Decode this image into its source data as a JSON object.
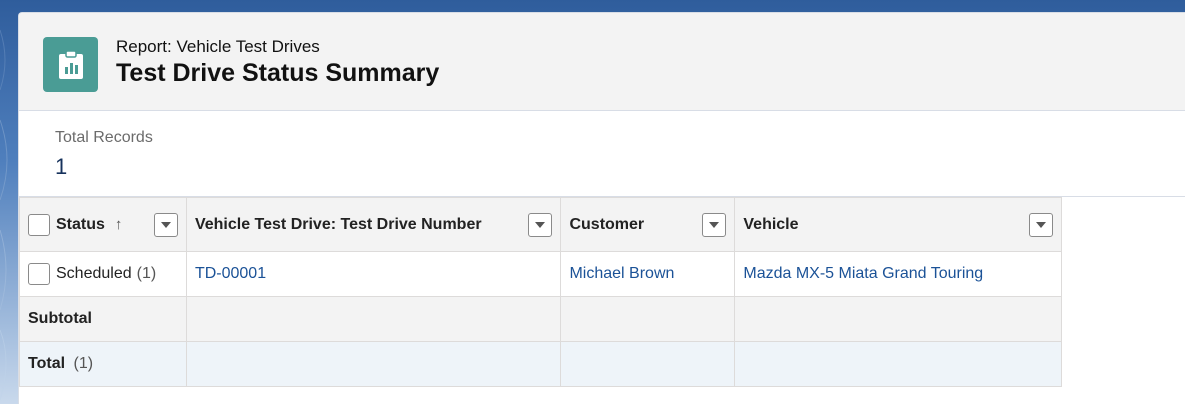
{
  "header": {
    "subtitle": "Report: Vehicle Test Drives",
    "title": "Test Drive Status Summary",
    "icon": "report-icon"
  },
  "metric": {
    "label": "Total Records",
    "value": "1"
  },
  "table": {
    "columns": [
      {
        "label": "Status",
        "sort": "↑"
      },
      {
        "label": "Vehicle Test Drive: Test Drive Number"
      },
      {
        "label": "Customer"
      },
      {
        "label": "Vehicle"
      }
    ],
    "rows": [
      {
        "status": "Scheduled",
        "status_count": "(1)",
        "test_drive_number": "TD-00001",
        "customer": "Michael Brown",
        "vehicle": "Mazda MX-5 Miata Grand Touring"
      }
    ],
    "subtotal_label": "Subtotal",
    "total_label": "Total",
    "total_count": "(1)"
  },
  "colors": {
    "icon_bg": "#4a9c95",
    "link": "#1b5297",
    "metric_value": "#16325c"
  }
}
